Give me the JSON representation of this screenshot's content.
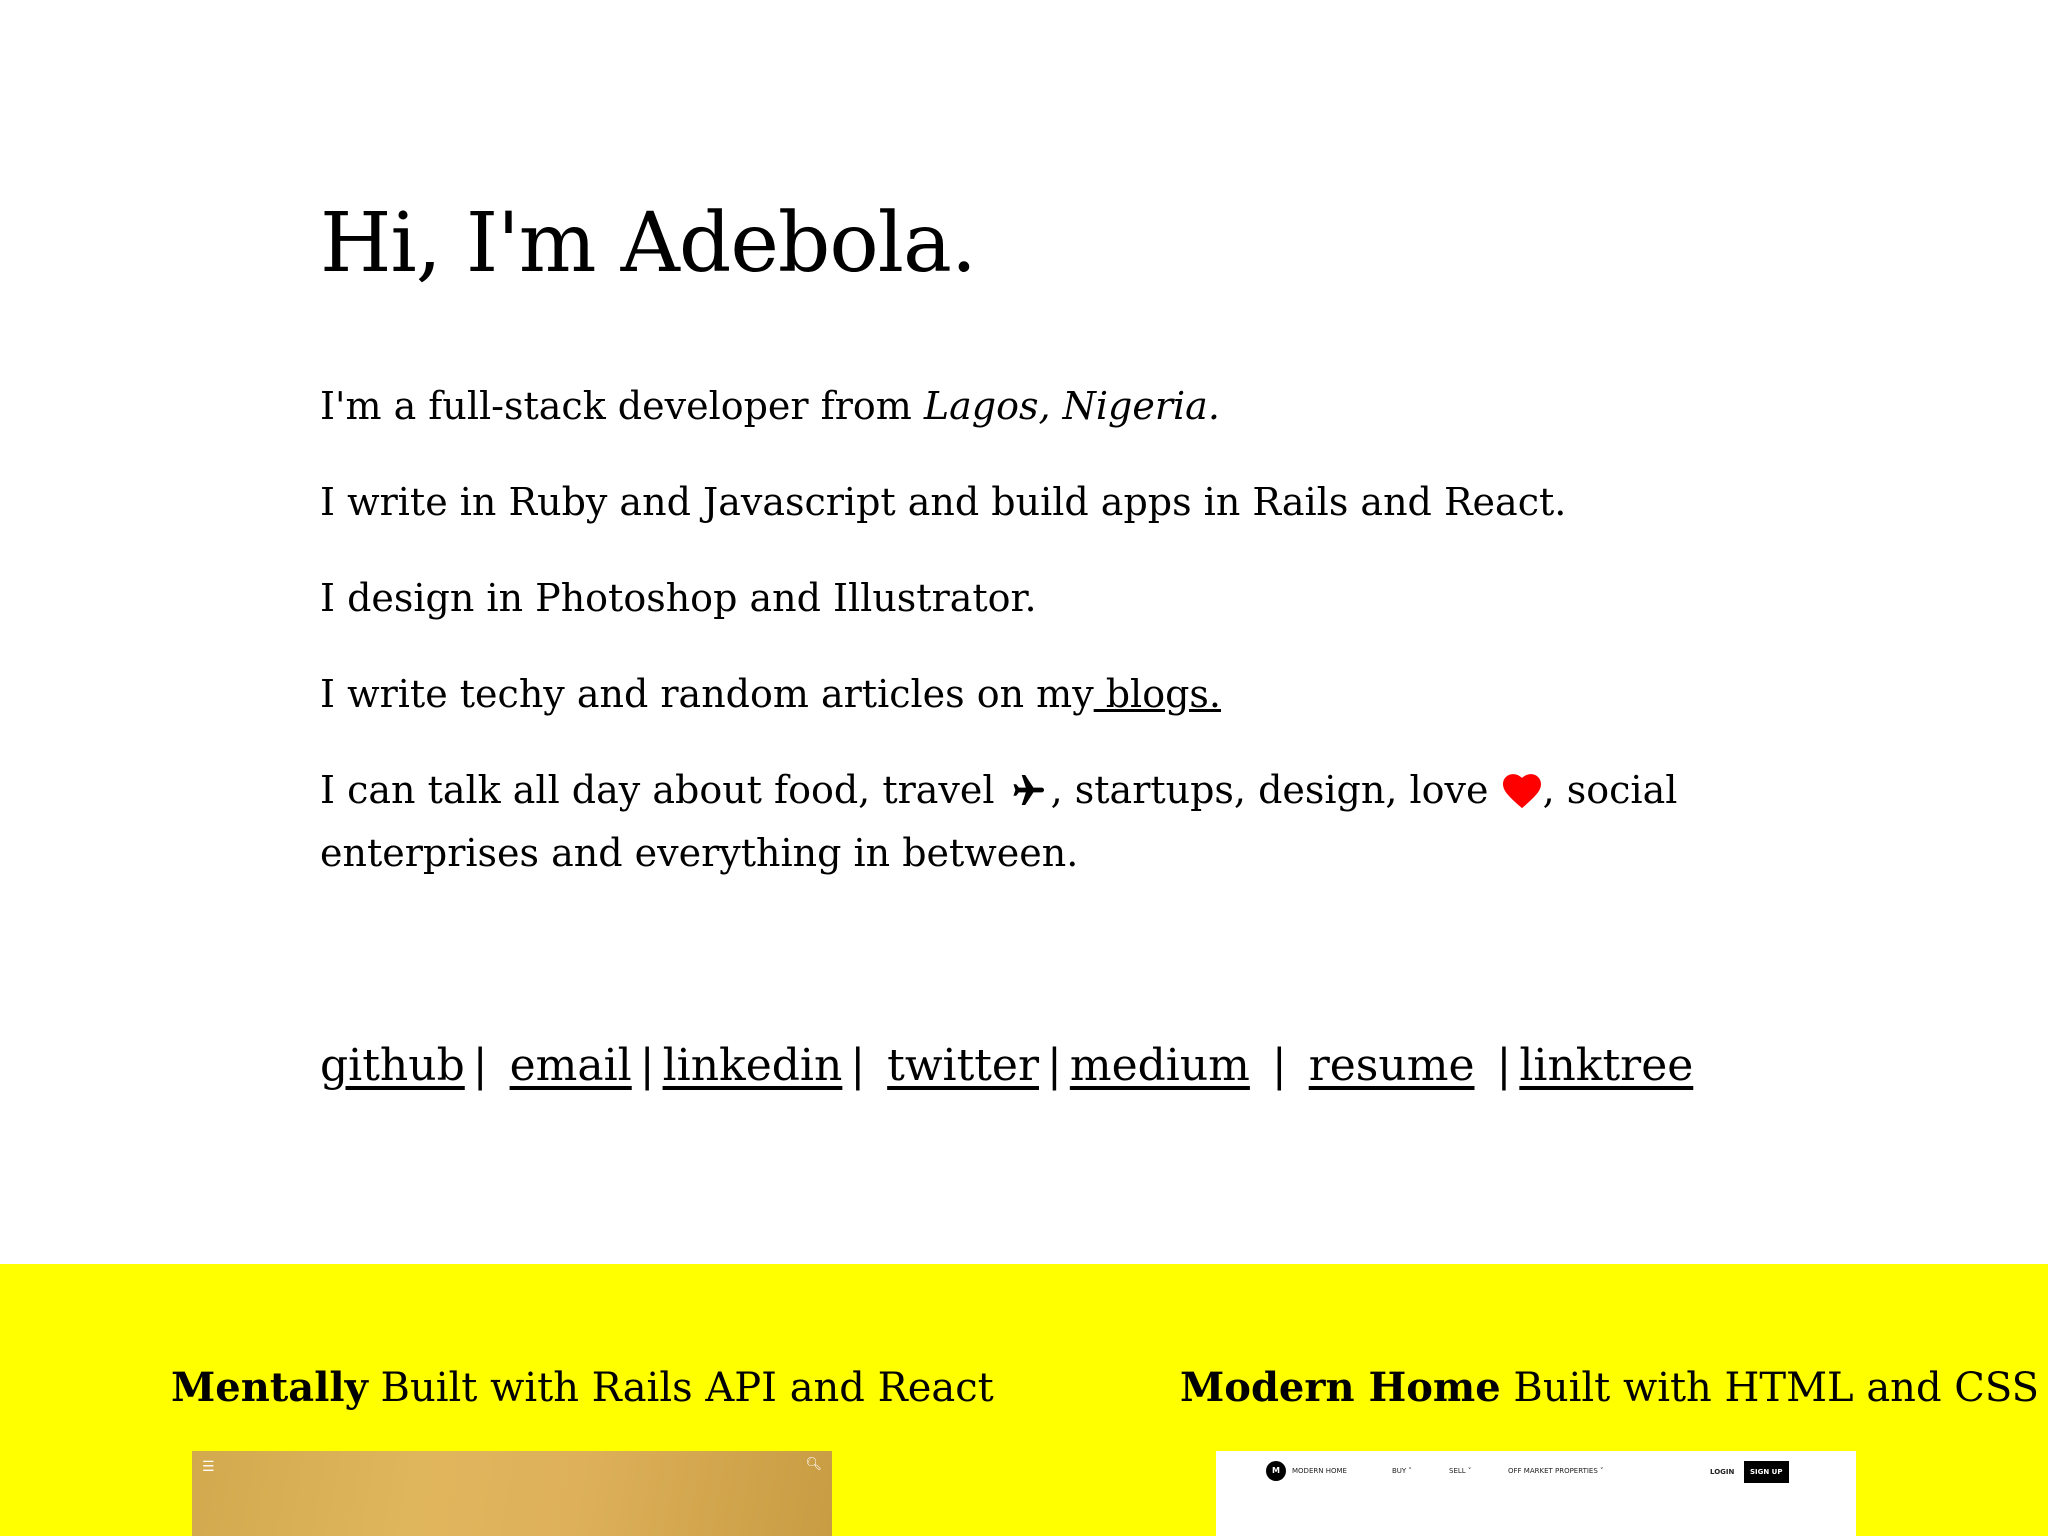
{
  "intro": {
    "greeting": "Hi, I'm Adebola.",
    "line1_prefix": "I'm a full-stack developer from ",
    "line1_location": "Lagos, Nigeria.",
    "line2": "I write in Ruby and Javascript and build apps in Rails and React.",
    "line3": "I design in Photoshop and Illustrator.",
    "line4_prefix": "I write techy and random articles on my",
    "line4_link": " blogs.",
    "line5_a": "I can talk all day about food, travel ",
    "line5_b": ", startups, design, love ",
    "line5_c": ", social enterprises and everything in between.",
    "icons": [
      "airplane-icon",
      "heart-icon"
    ],
    "heart_color": "#ff0000"
  },
  "links": {
    "github": "github",
    "email": "email",
    "linkedin": "linkedin",
    "twitter": "twitter",
    "medium": "medium",
    "resume": "resume",
    "linktree": "linktree",
    "separator": "|"
  },
  "projects": {
    "background_color": "#ffff00",
    "items": [
      {
        "name": "Mentally",
        "description": " Built with Rails API and React"
      },
      {
        "name": "Modern Home",
        "description": " Built with HTML and CSS",
        "preview_nav": {
          "logo": "M",
          "brand": "MODERN HOME",
          "buy": "BUY ˅",
          "sell": "SELL ˅",
          "off_market": "OFF MARKET PROPERTIES ˅",
          "login": "LOGIN",
          "signup": "SIGN UP"
        }
      }
    ]
  }
}
